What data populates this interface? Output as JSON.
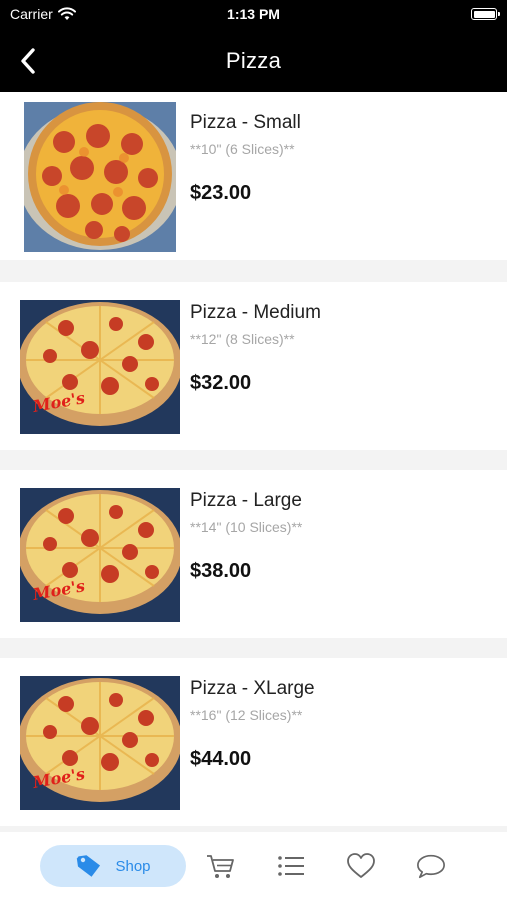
{
  "status_bar": {
    "carrier": "Carrier",
    "time": "1:13 PM"
  },
  "nav": {
    "title": "Pizza"
  },
  "products": [
    {
      "name": "Pizza - Small",
      "description": "**10\" (6 Slices)**",
      "price": "$23.00",
      "image": "pepperoni-pizza-photo"
    },
    {
      "name": "Pizza - Medium",
      "description": "**12\" (8 Slices)**",
      "price": "$32.00",
      "image": "pepperoni-pizza-photo",
      "logo_text": "Moe's"
    },
    {
      "name": "Pizza - Large",
      "description": "**14\" (10 Slices)**",
      "price": "$38.00",
      "image": "pepperoni-pizza-photo",
      "logo_text": "Moe's"
    },
    {
      "name": "Pizza - XLarge",
      "description": "**16\" (12 Slices)**",
      "price": "$44.00",
      "image": "pepperoni-pizza-photo",
      "logo_text": "Moe's"
    }
  ],
  "tab_bar": {
    "shop_label": "Shop",
    "accent_color": "#2a8be8",
    "active_bg": "#cfe6fb",
    "icons": [
      "tag-icon",
      "cart-icon",
      "list-icon",
      "heart-icon",
      "chat-icon"
    ]
  }
}
